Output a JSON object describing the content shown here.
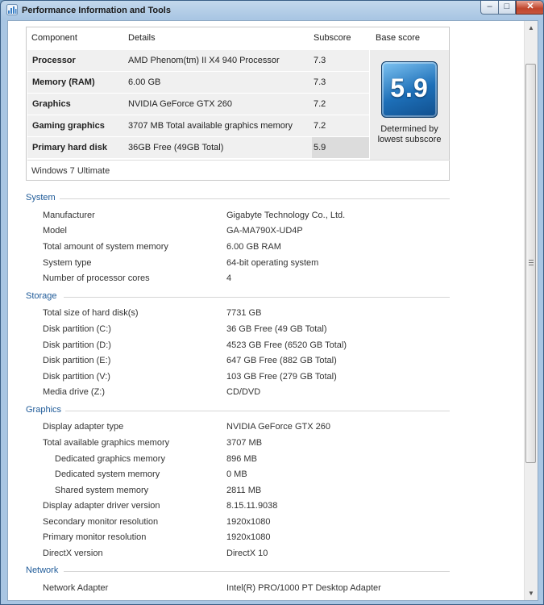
{
  "window": {
    "title": "Performance Information and Tools",
    "min": "–",
    "max": "□",
    "close": "✕"
  },
  "scores": {
    "headers": {
      "component": "Component",
      "details": "Details",
      "subscore": "Subscore",
      "base": "Base score"
    },
    "rows": [
      {
        "component": "Processor",
        "details": "AMD Phenom(tm) II X4 940 Processor",
        "subscore": "7.3"
      },
      {
        "component": "Memory (RAM)",
        "details": "6.00 GB",
        "subscore": "7.3"
      },
      {
        "component": "Graphics",
        "details": "NVIDIA GeForce GTX 260",
        "subscore": "7.2"
      },
      {
        "component": "Gaming graphics",
        "details": "3707 MB Total available graphics memory",
        "subscore": "7.2"
      },
      {
        "component": "Primary hard disk",
        "details": "36GB Free (49GB Total)",
        "subscore": "5.9"
      }
    ],
    "base_score": "5.9",
    "base_note_1": "Determined by",
    "base_note_2": "lowest subscore",
    "edition": "Windows 7 Ultimate"
  },
  "sections": {
    "system": {
      "title": "System",
      "items": [
        {
          "label": "Manufacturer",
          "value": "Gigabyte Technology Co., Ltd."
        },
        {
          "label": "Model",
          "value": "GA-MA790X-UD4P"
        },
        {
          "label": "Total amount of system memory",
          "value": "6.00 GB RAM"
        },
        {
          "label": "System type",
          "value": "64-bit operating system"
        },
        {
          "label": "Number of processor cores",
          "value": "4"
        }
      ]
    },
    "storage": {
      "title": "Storage",
      "items": [
        {
          "label": "Total size of hard disk(s)",
          "value": "7731 GB"
        },
        {
          "label": "Disk partition (C:)",
          "value": "36 GB Free (49 GB Total)"
        },
        {
          "label": "Disk partition (D:)",
          "value": "4523 GB Free (6520 GB Total)"
        },
        {
          "label": "Disk partition (E:)",
          "value": "647 GB Free (882 GB Total)"
        },
        {
          "label": "Disk partition (V:)",
          "value": "103 GB Free (279 GB Total)"
        },
        {
          "label": "Media drive (Z:)",
          "value": "CD/DVD"
        }
      ]
    },
    "graphics": {
      "title": "Graphics",
      "items": [
        {
          "label": "Display adapter type",
          "value": "NVIDIA GeForce GTX 260"
        },
        {
          "label": "Total available graphics memory",
          "value": "3707 MB"
        },
        {
          "label": "Dedicated graphics memory",
          "value": "896 MB"
        },
        {
          "label": "Dedicated system memory",
          "value": "0 MB"
        },
        {
          "label": "Shared system memory",
          "value": "2811 MB"
        },
        {
          "label": "Display adapter driver version",
          "value": "8.15.11.9038"
        },
        {
          "label": "Secondary monitor resolution",
          "value": "1920x1080"
        },
        {
          "label": "Primary monitor resolution",
          "value": "1920x1080"
        },
        {
          "label": "DirectX version",
          "value": "DirectX 10"
        }
      ]
    },
    "network": {
      "title": "Network",
      "items": [
        {
          "label": "Network Adapter",
          "value": "Intel(R) PRO/1000 PT Desktop Adapter"
        }
      ]
    }
  },
  "colors": {
    "accent": "#1e5a98",
    "badge": "#1d6fb8"
  },
  "icons": {
    "window": "performance-icon",
    "scroll_up": "scroll-up-arrow-icon",
    "scroll_down": "scroll-down-arrow-icon"
  }
}
